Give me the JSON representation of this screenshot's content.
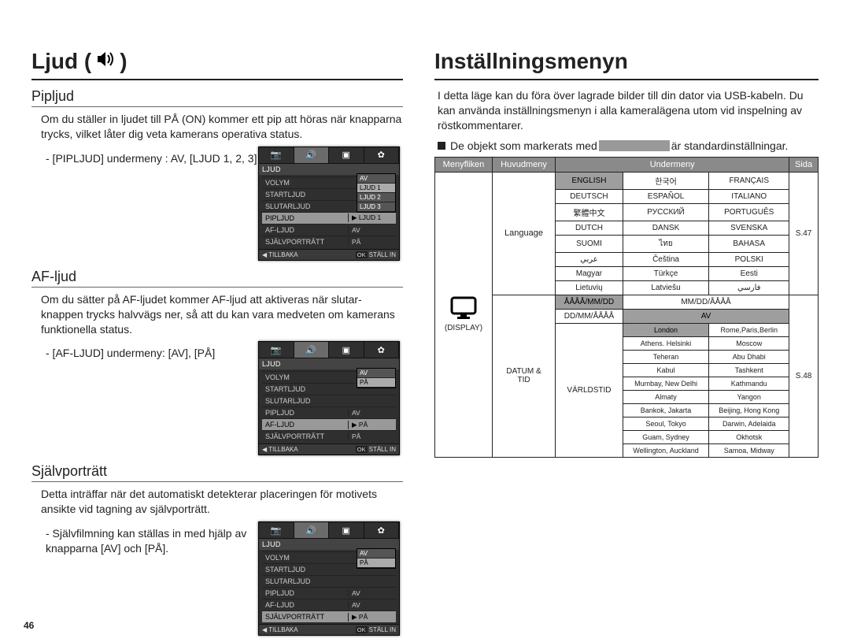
{
  "pageNumber": "46",
  "left": {
    "title": "Ljud (",
    "titleClose": ")",
    "sections": [
      {
        "heading": "Pipljud",
        "body": "Om du ställer in ljudet till PÅ (ON) kommer ett pip att höras när knapparna trycks, vilket låter dig veta kamerans operativa status.",
        "sub": "- [PIPLJUD] undermeny : AV, [LJUD 1, 2, 3]",
        "screenSelected": "PIPLJUD",
        "popup": [
          "AV",
          "LJUD 1",
          "LJUD 2",
          "LJUD 3"
        ],
        "popupSel": 1
      },
      {
        "heading": "AF-ljud",
        "body": "Om du sätter på AF-ljudet kommer AF-ljud att aktiveras när slutar-knappen trycks halvvägs ner, så att du kan vara medveten om kamerans funktionella status.",
        "sub": "- [AF-LJUD] undermeny: [AV], [PÅ]",
        "screenSelected": "AF-LJUD",
        "popup": [
          "AV",
          "PÅ"
        ],
        "popupSel": 1
      },
      {
        "heading": "Självporträtt",
        "body": "Detta inträffar när det automatiskt detekterar placeringen för motivets ansikte vid tagning av självporträtt.",
        "sub": "- Självfilmning kan ställas in med hjälp av knapparna [AV] och [PÅ].",
        "screenSelected": "SJÄLVPORTRÄTT",
        "popup": [
          "AV",
          "PÅ"
        ],
        "popupSel": 1
      }
    ],
    "camMenu": {
      "title": "LJUD",
      "rows": [
        "VOLYM",
        "STARTLJUD",
        "SLUTARLJUD",
        "PIPLJUD",
        "AF-LJUD",
        "SJÄLVPORTRÄTT"
      ],
      "vals": {
        "PIPLJUD": "AV",
        "AF-LJUD": "AV",
        "SJÄLVPORTRÄTT": "PÅ"
      },
      "footerLeft": "◀  TILLBAKA",
      "footerRight": "STÄLL IN",
      "footerOk": "OK"
    }
  },
  "right": {
    "title": "Inställningsmenyn",
    "intro": "I detta läge kan du föra över lagrade bilder till din dator via USB-kabeln. Du kan använda inställningsmenyn i alla kameralägena utom vid inspelning av röstkommentarer.",
    "bulletPre": "De objekt som markerats med",
    "bulletPost": "är standardinställningar.",
    "tableHead": [
      "Menyfliken",
      "Huvudmeny",
      "Undermeny",
      "Sida"
    ],
    "language": {
      "label": "Language",
      "page": "S.47",
      "rows": [
        [
          "ENGLISH",
          "한국어",
          "FRANÇAIS"
        ],
        [
          "DEUTSCH",
          "ESPAÑOL",
          "ITALIANO"
        ],
        [
          "繁體中文",
          "РУССКИЙ",
          "PORTUGUÊS"
        ],
        [
          "DUTCH",
          "DANSK",
          "SVENSKA"
        ],
        [
          "SUOMI",
          "ไทย",
          "BAHASA"
        ],
        [
          "عربي",
          "Čeština",
          "POLSKI"
        ],
        [
          "Magyar",
          "Türkçe",
          "Eesti"
        ],
        [
          "Lietuvių",
          "Latviešu",
          "فارسي"
        ]
      ]
    },
    "displayLabel": "(DISPLAY)",
    "datumTid": {
      "label1": "DATUM &",
      "label2": "TID",
      "page": "S.48",
      "dateRows": [
        [
          "ÅÅÅÅ/MM/DD",
          "MM/DD/ÅÅÅÅ"
        ],
        [
          "DD/MM/ÅÅÅÅ",
          "AV"
        ]
      ],
      "worldLabel": "VÄRLDSTID",
      "worldRows": [
        [
          "London",
          "Rome,Paris,Berlin"
        ],
        [
          "Athens. Helsinki",
          "Moscow"
        ],
        [
          "Teheran",
          "Abu Dhabi"
        ],
        [
          "Kabul",
          "Tashkent"
        ],
        [
          "Mumbay, New Delhi",
          "Kathmandu"
        ],
        [
          "Almaty",
          "Yangon"
        ],
        [
          "Bankok, Jakarta",
          "Beijing, Hong Kong"
        ],
        [
          "Seoul, Tokyo",
          "Darwin, Adelaida"
        ],
        [
          "Guam, Sydney",
          "Okhotsk"
        ],
        [
          "Wellington, Auckland",
          "Samoa, Midway"
        ]
      ]
    }
  }
}
